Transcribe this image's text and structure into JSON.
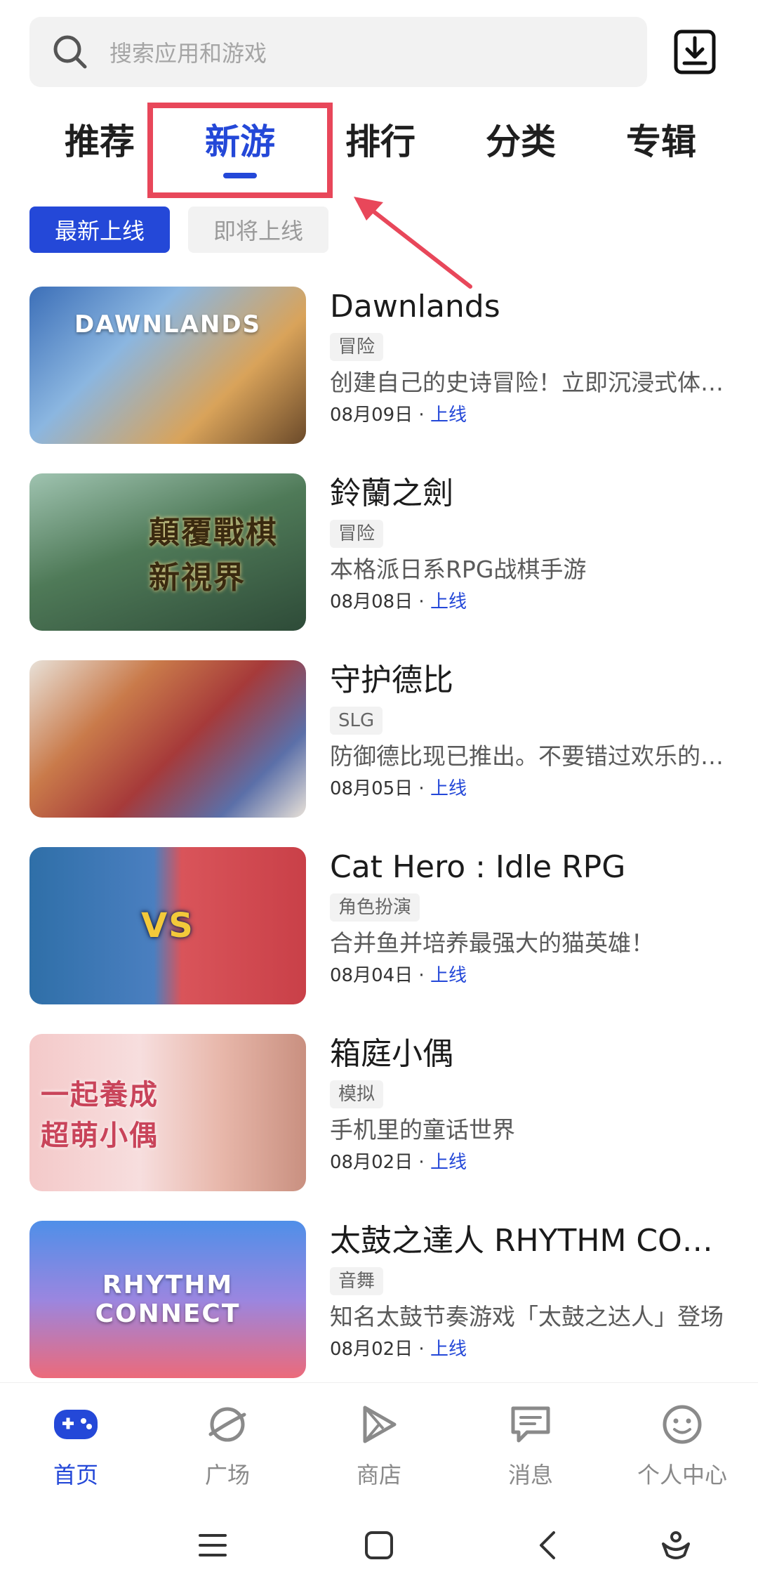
{
  "search": {
    "placeholder": "搜索应用和游戏"
  },
  "tabs": [
    {
      "label": "推荐"
    },
    {
      "label": "新游"
    },
    {
      "label": "排行"
    },
    {
      "label": "分类"
    },
    {
      "label": "专辑"
    }
  ],
  "subtabs": [
    {
      "label": "最新上线"
    },
    {
      "label": "即将上线"
    }
  ],
  "games": [
    {
      "title": "Dawnlands",
      "tag": "冒险",
      "desc": "创建自己的史诗冒险！立即沉浸式体验全新世界",
      "date": "08月09日",
      "sep": " · ",
      "status": "上线",
      "thumb_text": "DAWNLANDS"
    },
    {
      "title": "鈴蘭之劍",
      "tag": "冒险",
      "desc": "本格派日系RPG战棋手游",
      "date": "08月08日",
      "sep": " · ",
      "status": "上线",
      "thumb_text": "顛覆戰棋 新視界"
    },
    {
      "title": "守护德比",
      "tag": "SLG",
      "desc": "防御德比现已推出。不要错过欢乐的战斗",
      "date": "08月05日",
      "sep": " · ",
      "status": "上线",
      "thumb_text": ""
    },
    {
      "title": "Cat Hero : Idle RPG",
      "tag": "角色扮演",
      "desc": "合并鱼并培养最强大的猫英雄！",
      "date": "08月04日",
      "sep": " · ",
      "status": "上线",
      "thumb_text": "VS"
    },
    {
      "title": "箱庭小偶",
      "tag": "模拟",
      "desc": "手机里的童话世界",
      "date": "08月02日",
      "sep": " · ",
      "status": "上线",
      "thumb_text": "一起養成 超萌小偶"
    },
    {
      "title": "太鼓之達人 RHYTHM CONNECT",
      "tag": "音舞",
      "desc": "知名太鼓节奏游戏「太鼓之达人」登场",
      "date": "08月02日",
      "sep": " · ",
      "status": "上线",
      "thumb_text": "RHYTHM CONNECT"
    }
  ],
  "bottom_nav": [
    {
      "label": "首页",
      "icon": "gamepad-icon"
    },
    {
      "label": "广场",
      "icon": "planet-icon"
    },
    {
      "label": "商店",
      "icon": "play-store-icon"
    },
    {
      "label": "消息",
      "icon": "message-icon"
    },
    {
      "label": "个人中心",
      "icon": "smiley-icon"
    }
  ],
  "colors": {
    "accent": "#2448d8",
    "highlight": "#e8475a"
  }
}
